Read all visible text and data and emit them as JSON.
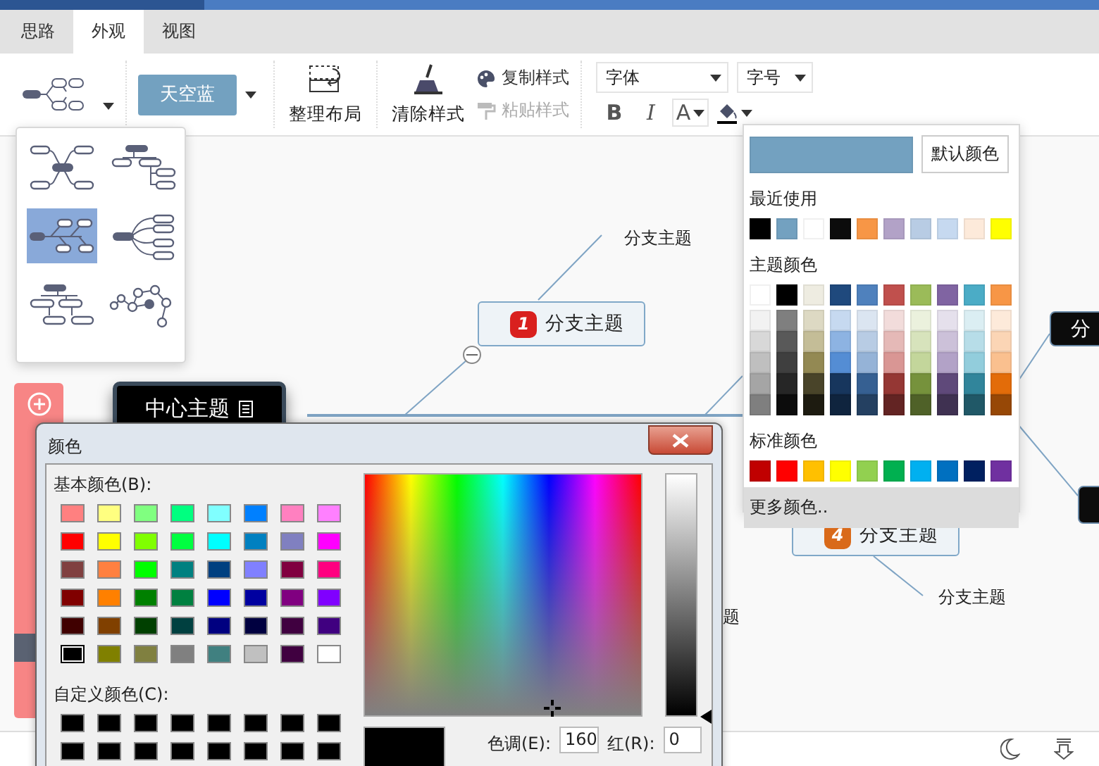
{
  "tabs": [
    {
      "label": "思路",
      "selected": false
    },
    {
      "label": "外观",
      "selected": true
    },
    {
      "label": "视图",
      "selected": false
    }
  ],
  "toolbar": {
    "theme_button": "天空蓝",
    "arrange_button": "整理布局",
    "clear_style_button": "清除样式",
    "copy_style": {
      "label": "复制样式",
      "disabled": false
    },
    "paste_style": {
      "label": "粘贴样式",
      "disabled": true
    },
    "font_select": "字体",
    "size_select": "字号",
    "bold": "B",
    "italic": "I",
    "font_color": "A"
  },
  "layout_menu": [
    {
      "kind": "map",
      "selected": false
    },
    {
      "kind": "tree",
      "selected": false
    },
    {
      "kind": "logic",
      "selected": true
    },
    {
      "kind": "bracket",
      "selected": false
    },
    {
      "kind": "org",
      "selected": false
    },
    {
      "kind": "bubble",
      "selected": false
    }
  ],
  "nodes": [
    {
      "kind": "center",
      "label": "中心主题"
    },
    {
      "kind": "branch",
      "label": "分支主题",
      "badge": "1",
      "color": "#d9201e"
    },
    {
      "kind": "sub",
      "label": "分支主题"
    },
    {
      "kind": "dark",
      "label": "分"
    },
    {
      "kind": "branch",
      "label": "分支主题",
      "badge": "4",
      "color": "#d96a1a"
    },
    {
      "kind": "sub",
      "label": "分支主题"
    },
    {
      "kind": "sub",
      "label": "题"
    },
    {
      "kind": "dark"
    }
  ],
  "color_popup": {
    "current": {
      "color": "#73a1c0"
    },
    "default_button": "默认颜色",
    "recent_label": "最近使用",
    "recent": [
      {
        "color": "#000000"
      },
      {
        "color": "#73a1c0"
      },
      {
        "color": "#ffffff"
      },
      {
        "color": "#0c0c0c"
      },
      {
        "color": "#f79646"
      },
      {
        "color": "#b2a2c7"
      },
      {
        "color": "#b8cce4"
      },
      {
        "color": "#c6d9f0"
      },
      {
        "color": "#fdeada"
      },
      {
        "color": "#ffff00"
      }
    ],
    "theme_label": "主题颜色",
    "theme_base": [
      {
        "color": "#ffffff"
      },
      {
        "color": "#000000"
      },
      {
        "color": "#eeece1"
      },
      {
        "color": "#1f497d"
      },
      {
        "color": "#4f81bd"
      },
      {
        "color": "#c0504d"
      },
      {
        "color": "#9bbb59"
      },
      {
        "color": "#8064a2"
      },
      {
        "color": "#4bacc6"
      },
      {
        "color": "#f79646"
      }
    ],
    "theme_shades": [
      [
        {
          "color": "#f2f2f2"
        },
        {
          "color": "#7f7f7f"
        },
        {
          "color": "#ddd9c3"
        },
        {
          "color": "#c6d9f0"
        },
        {
          "color": "#dbe5f1"
        },
        {
          "color": "#f2dcdb"
        },
        {
          "color": "#ebf1dd"
        },
        {
          "color": "#e5e0ec"
        },
        {
          "color": "#dbeef3"
        },
        {
          "color": "#fdeada"
        }
      ],
      [
        {
          "color": "#d8d8d8"
        },
        {
          "color": "#595959"
        },
        {
          "color": "#c4bd97"
        },
        {
          "color": "#8db3e2"
        },
        {
          "color": "#b8cce4"
        },
        {
          "color": "#e5b9b7"
        },
        {
          "color": "#d7e3bc"
        },
        {
          "color": "#ccc1d9"
        },
        {
          "color": "#b7dde8"
        },
        {
          "color": "#fbd5b5"
        }
      ],
      [
        {
          "color": "#bfbfbf"
        },
        {
          "color": "#3f3f3f"
        },
        {
          "color": "#938953"
        },
        {
          "color": "#548dd4"
        },
        {
          "color": "#95b3d7"
        },
        {
          "color": "#d99694"
        },
        {
          "color": "#c3d69b"
        },
        {
          "color": "#b2a2c7"
        },
        {
          "color": "#92cddc"
        },
        {
          "color": "#fac08f"
        }
      ],
      [
        {
          "color": "#a5a5a5"
        },
        {
          "color": "#262626"
        },
        {
          "color": "#494429"
        },
        {
          "color": "#17365d"
        },
        {
          "color": "#366092"
        },
        {
          "color": "#953734"
        },
        {
          "color": "#76923c"
        },
        {
          "color": "#5f497a"
        },
        {
          "color": "#31859b"
        },
        {
          "color": "#e36c09"
        }
      ],
      [
        {
          "color": "#7f7f7f"
        },
        {
          "color": "#0c0c0c"
        },
        {
          "color": "#1d1b10"
        },
        {
          "color": "#0f243e"
        },
        {
          "color": "#244061"
        },
        {
          "color": "#632423"
        },
        {
          "color": "#4f6128"
        },
        {
          "color": "#3f3151"
        },
        {
          "color": "#205867"
        },
        {
          "color": "#974806"
        }
      ]
    ],
    "standard_label": "标准颜色",
    "standard": [
      {
        "color": "#c00000"
      },
      {
        "color": "#ff0000"
      },
      {
        "color": "#ffc000"
      },
      {
        "color": "#ffff00"
      },
      {
        "color": "#92d050"
      },
      {
        "color": "#00b050"
      },
      {
        "color": "#00b0f0"
      },
      {
        "color": "#0070c0"
      },
      {
        "color": "#002060"
      },
      {
        "color": "#7030a0"
      }
    ],
    "more_button": "更多颜色.."
  },
  "color_dialog": {
    "title": "颜色",
    "basic_label": "基本颜色(B):",
    "basic": [
      {
        "color": "#ff8080",
        "selected": false
      },
      {
        "color": "#ffff80",
        "selected": false
      },
      {
        "color": "#80ff80",
        "selected": false
      },
      {
        "color": "#00ff80",
        "selected": false
      },
      {
        "color": "#80ffff",
        "selected": false
      },
      {
        "color": "#0080ff",
        "selected": false
      },
      {
        "color": "#ff80c0",
        "selected": false
      },
      {
        "color": "#ff80ff",
        "selected": false
      },
      {
        "color": "#ff0000",
        "selected": false
      },
      {
        "color": "#ffff00",
        "selected": false
      },
      {
        "color": "#80ff00",
        "selected": false
      },
      {
        "color": "#00ff40",
        "selected": false
      },
      {
        "color": "#00ffff",
        "selected": false
      },
      {
        "color": "#0080c0",
        "selected": false
      },
      {
        "color": "#8080c0",
        "selected": false
      },
      {
        "color": "#ff00ff",
        "selected": false
      },
      {
        "color": "#804040",
        "selected": false
      },
      {
        "color": "#ff8040",
        "selected": false
      },
      {
        "color": "#00ff00",
        "selected": false
      },
      {
        "color": "#008080",
        "selected": false
      },
      {
        "color": "#004080",
        "selected": false
      },
      {
        "color": "#8080ff",
        "selected": false
      },
      {
        "color": "#800040",
        "selected": false
      },
      {
        "color": "#ff0080",
        "selected": false
      },
      {
        "color": "#800000",
        "selected": false
      },
      {
        "color": "#ff8000",
        "selected": false
      },
      {
        "color": "#008000",
        "selected": false
      },
      {
        "color": "#008040",
        "selected": false
      },
      {
        "color": "#0000ff",
        "selected": false
      },
      {
        "color": "#0000a0",
        "selected": false
      },
      {
        "color": "#800080",
        "selected": false
      },
      {
        "color": "#8000ff",
        "selected": false
      },
      {
        "color": "#400000",
        "selected": false
      },
      {
        "color": "#804000",
        "selected": false
      },
      {
        "color": "#004000",
        "selected": false
      },
      {
        "color": "#004040",
        "selected": false
      },
      {
        "color": "#000080",
        "selected": false
      },
      {
        "color": "#000040",
        "selected": false
      },
      {
        "color": "#400040",
        "selected": false
      },
      {
        "color": "#400080",
        "selected": false
      },
      {
        "color": "#000000",
        "selected": true
      },
      {
        "color": "#808000",
        "selected": false
      },
      {
        "color": "#808040",
        "selected": false
      },
      {
        "color": "#808080",
        "selected": false
      },
      {
        "color": "#408080",
        "selected": false
      },
      {
        "color": "#c0c0c0",
        "selected": false
      },
      {
        "color": "#400040",
        "selected": false
      },
      {
        "color": "#ffffff",
        "selected": false
      }
    ],
    "custom_label": "自定义颜色(C):",
    "custom": [
      {
        "color": "#000000"
      },
      {
        "color": "#000000"
      },
      {
        "color": "#000000"
      },
      {
        "color": "#000000"
      },
      {
        "color": "#000000"
      },
      {
        "color": "#000000"
      },
      {
        "color": "#000000"
      },
      {
        "color": "#000000"
      },
      {
        "color": "#000000"
      },
      {
        "color": "#000000"
      },
      {
        "color": "#000000"
      },
      {
        "color": "#000000"
      },
      {
        "color": "#000000"
      },
      {
        "color": "#000000"
      },
      {
        "color": "#000000"
      },
      {
        "color": "#000000"
      }
    ],
    "preview": {
      "color": "#000000"
    },
    "hue_label": "色调(E):",
    "hue": "160",
    "red_label": "红(R):",
    "red": "0"
  }
}
